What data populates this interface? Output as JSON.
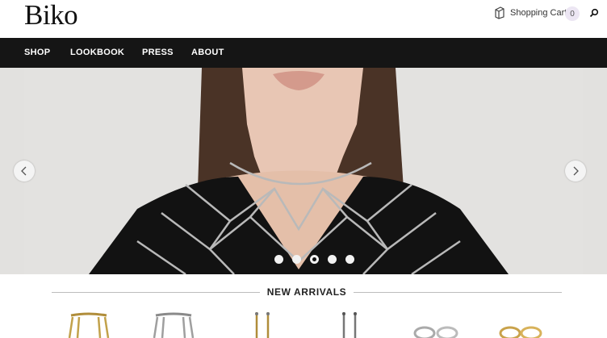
{
  "header": {
    "logo": "Biko",
    "cart_label": "Shopping Cart",
    "cart_count": "0"
  },
  "nav": {
    "items": [
      {
        "label": "SHOP"
      },
      {
        "label": "LOOKBOOK"
      },
      {
        "label": "PRESS"
      },
      {
        "label": "ABOUT"
      }
    ]
  },
  "hero": {
    "active_slide": 3,
    "slide_count": 5
  },
  "new_arrivals": {
    "title": "NEW ARRIVALS"
  },
  "icons": {
    "cart": "cart-icon",
    "search": "search-icon",
    "prev": "chevron-left-icon",
    "next": "chevron-right-icon"
  },
  "colors": {
    "nav_bg": "#151515",
    "accent_badge": "#ece6f3"
  }
}
